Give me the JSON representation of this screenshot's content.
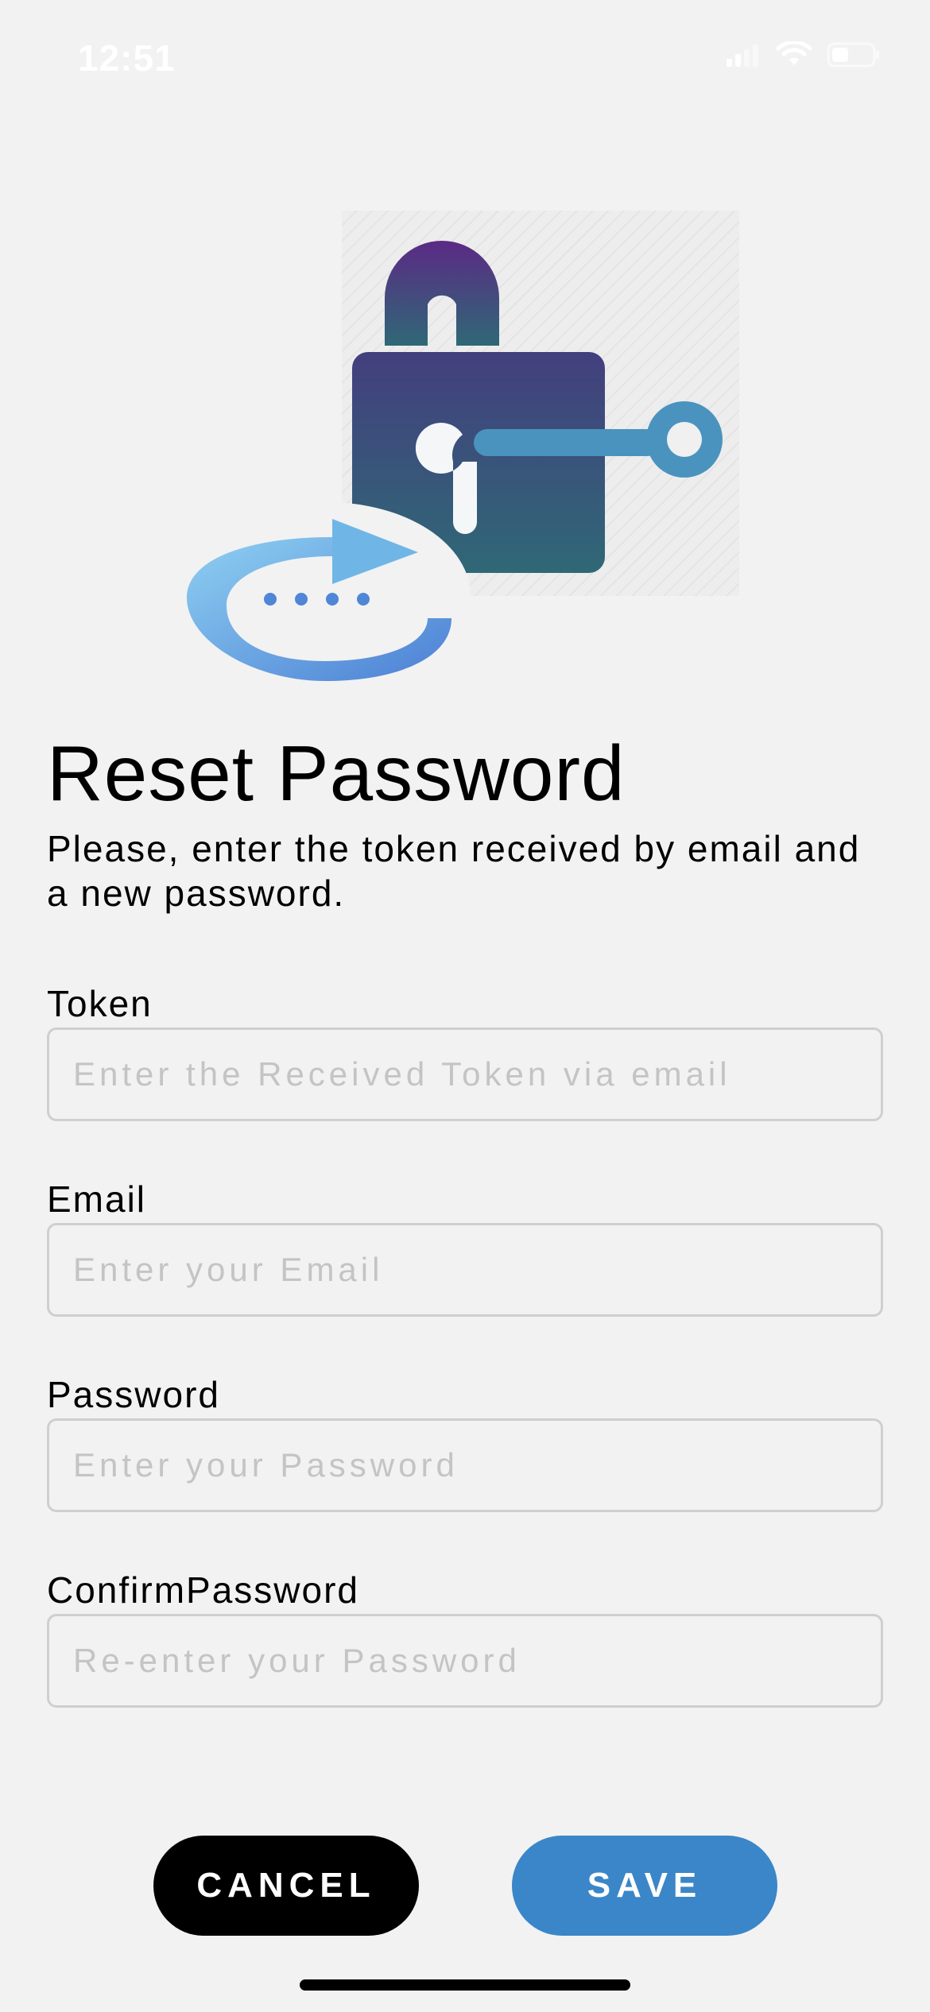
{
  "status_bar": {
    "time": "12:51",
    "icons": [
      "signal-icon",
      "wifi-icon",
      "battery-icon"
    ]
  },
  "illustration": {
    "icon": "lock-key-reset-illustration",
    "colors": {
      "lock_top": "#5b2a85",
      "lock_bottom": "#2f6876",
      "key": "#4a93bf",
      "refresh_light": "#84c8ee",
      "refresh_dark": "#4f86d6"
    }
  },
  "header": {
    "title": "Reset Password",
    "subtitle": "Please, enter the token received by email and a new password."
  },
  "form": {
    "token": {
      "label": "Token",
      "value": "",
      "placeholder": "Enter the Received Token via email"
    },
    "email": {
      "label": "Email",
      "value": "",
      "placeholder": "Enter your Email"
    },
    "password": {
      "label": "Password",
      "value": "",
      "placeholder": "Enter your Password"
    },
    "confirm_password": {
      "label": "ConfirmPassword",
      "value": "",
      "placeholder": "Re-enter your Password"
    }
  },
  "actions": {
    "cancel_label": "CANCEL",
    "save_label": "SAVE"
  },
  "colors": {
    "background": "#f2f2f2",
    "cancel_button": "#000000",
    "save_button": "#3a86c8",
    "input_border": "#cfcfcf",
    "placeholder": "#c4c4c4"
  }
}
